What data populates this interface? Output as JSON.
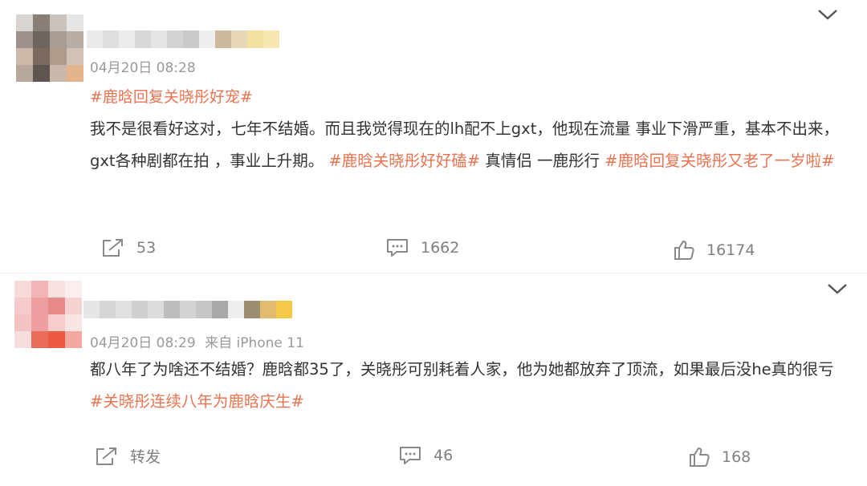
{
  "colors": {
    "link": "#eb7350",
    "text": "#333333",
    "meta": "#9a9a9a",
    "action": "#808080"
  },
  "posts": [
    {
      "time": "04月20日 08:28",
      "source": "",
      "title_tag": "#鹿晗回复关晓彤好宠#",
      "text_1": "我不是很看好这对，七年不结婚。而且我觉得现在的lh配不上gxt，他现在流量 事业下滑严重，基本不出来，gxt各种剧都在拍 ，事业上升期。 ",
      "tag_1": "#鹿晗关晓彤好好磕#",
      "text_2": " 真情侣 一鹿彤行 ",
      "tag_2": "#鹿晗回复关晓彤又老了一岁啦#",
      "repost_icon": "share-icon",
      "repost_label": "53",
      "comment_icon": "comment-icon",
      "comment_count": "1662",
      "like_icon": "thumbs-up-icon",
      "like_count": "16174"
    },
    {
      "time": "04月20日 08:29",
      "source": "来自 iPhone 11",
      "text_1": "都八年了为啥还不结婚？鹿晗都35了，关晓彤可别耗着人家，他为她都放弃了顶流，如果最后没he真的很亏",
      "tag_1": "#关晓彤连续八年为鹿晗庆生#",
      "repost_icon": "share-icon",
      "repost_label": "转发",
      "comment_icon": "comment-icon",
      "comment_count": "46",
      "like_icon": "thumbs-up-icon",
      "like_count": "168"
    }
  ]
}
